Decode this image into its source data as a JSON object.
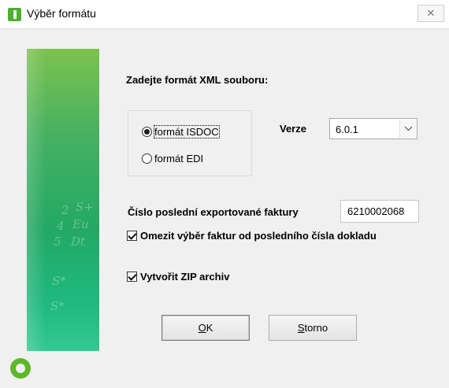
{
  "window": {
    "title": "Výběr formátu",
    "close_symbol": "✕"
  },
  "side_panel": {
    "decoration": [
      "2",
      "S+",
      "4",
      "Eu",
      "5",
      "Dt",
      "S*",
      "S*"
    ]
  },
  "form": {
    "prompt": "Zadejte formát XML souboru:",
    "format_options": [
      {
        "label": "formát ISDOC",
        "selected": true
      },
      {
        "label": "formát EDI",
        "selected": false
      }
    ],
    "version": {
      "label": "Verze",
      "value": "6.0.1"
    },
    "last_invoice": {
      "label": "Číslo poslední exportované faktury",
      "value": "6210002068"
    },
    "checkboxes": [
      {
        "label": "Omezit výběr faktur od posledního čísla dokladu",
        "checked": true
      },
      {
        "label": "Vytvořit ZIP archiv",
        "checked": true
      }
    ]
  },
  "buttons": {
    "ok": {
      "mnemonic": "O",
      "rest": "K"
    },
    "cancel": {
      "mnemonic": "S",
      "rest": "torno"
    }
  },
  "icons": {
    "app": "app-icon",
    "logo": "logo-icon",
    "dropdown": "chevron-down-icon"
  },
  "colors": {
    "accent_green": "#4caf32",
    "panel_top": "#7cc24f",
    "panel_bottom": "#35c892"
  }
}
